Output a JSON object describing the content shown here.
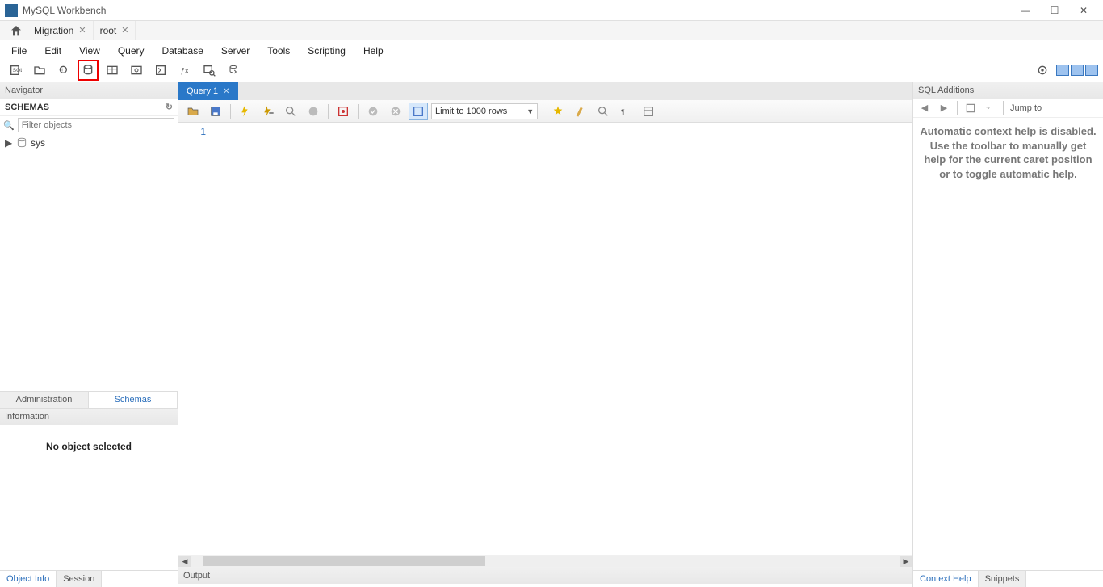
{
  "app": {
    "title": "MySQL Workbench"
  },
  "window_controls": {
    "min": "—",
    "max": "☐",
    "close": "✕"
  },
  "top_tabs": {
    "home_glyph": "🏠",
    "items": [
      {
        "label": "Migration"
      },
      {
        "label": "root"
      }
    ]
  },
  "menu": {
    "items": [
      "File",
      "Edit",
      "View",
      "Query",
      "Database",
      "Server",
      "Tools",
      "Scripting",
      "Help"
    ]
  },
  "main_toolbar": {
    "buttons": [
      "new-sql-tab-icon",
      "open-sql-script-icon",
      "inspector-icon",
      "create-schema-icon",
      "create-table-icon",
      "create-view-icon",
      "create-stored-procedure-icon",
      "create-function-icon",
      "search-table-data-icon",
      "reconnect-icon"
    ],
    "right_button": "settings-gear-icon",
    "highlighted_index": 3
  },
  "navigator": {
    "title": "Navigator",
    "schemas_label": "SCHEMAS",
    "refresh_glyph": "↻",
    "filter_placeholder": "Filter objects",
    "search_glyph": "🔍",
    "tree": [
      {
        "label": "sys"
      }
    ],
    "tabs": {
      "a": "Administration",
      "b": "Schemas",
      "active": "b"
    },
    "info_title": "Information",
    "info_text": "No object selected",
    "bottom_tabs": {
      "a": "Object Info",
      "b": "Session"
    }
  },
  "editor": {
    "tab_label": "Query 1",
    "toolbar": {
      "row_limit_label": "Limit to 1000 rows",
      "buttons_left": [
        "open-file-icon",
        "save-icon"
      ],
      "buttons_exec": [
        "execute-icon",
        "execute-current-icon",
        "explain-icon",
        "stop-icon"
      ],
      "buttons_mid": [
        "toggle-autocommit-icon",
        "commit-icon",
        "rollback-icon",
        "toggle-limit-icon"
      ],
      "buttons_right": [
        "beautify-icon",
        "find-replace-icon",
        "toggle-invisible-icon",
        "toggle-wrap-icon"
      ]
    },
    "gutter_lines": [
      "1"
    ],
    "output_label": "Output"
  },
  "additions": {
    "title": "SQL Additions",
    "nav": {
      "back": "◀",
      "forward": "▶"
    },
    "jump_label": "Jump to",
    "help_text": "Automatic context help is disabled. Use the toolbar to manually get help for the current caret position or to toggle automatic help.",
    "bottom_tabs": {
      "a": "Context Help",
      "b": "Snippets"
    }
  }
}
